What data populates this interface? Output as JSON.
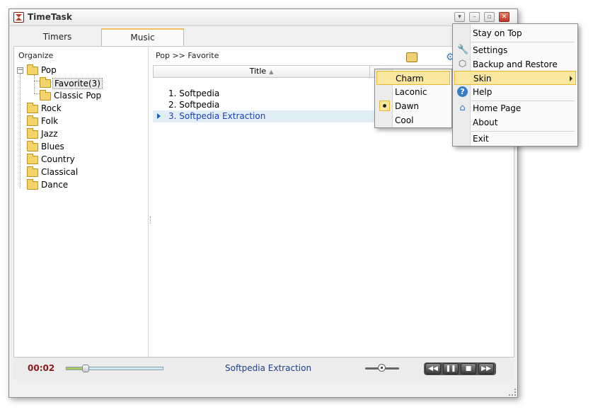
{
  "window": {
    "title": "TimeTask"
  },
  "tabs": [
    {
      "label": "Timers",
      "active": false
    },
    {
      "label": "Music",
      "active": true
    }
  ],
  "organize": {
    "label": "Organize",
    "tree": [
      {
        "label": "Pop",
        "expanded": true
      },
      {
        "label": "Favorite(3)",
        "selected": true
      },
      {
        "label": "Classic Pop"
      },
      {
        "label": "Rock"
      },
      {
        "label": "Folk"
      },
      {
        "label": "Jazz"
      },
      {
        "label": "Blues"
      },
      {
        "label": "Country"
      },
      {
        "label": "Classical"
      },
      {
        "label": "Dance"
      }
    ]
  },
  "playlist": {
    "breadcrumb": "Pop >> Favorite",
    "column_title": "Title",
    "songs": [
      {
        "label": "1. Softpedia"
      },
      {
        "label": "2. Softpedia"
      },
      {
        "label": "3. Softpedia Extraction",
        "playing": true
      }
    ]
  },
  "player": {
    "time": "00:02",
    "track": "Softpedia Extraction",
    "seek_fraction": 0.2,
    "volume_fraction": 0.5
  },
  "main_menu": [
    {
      "label": "Stay on Top"
    },
    {
      "label": "Settings",
      "icon": "wrench-icon"
    },
    {
      "label": "Backup and Restore",
      "icon": "backup-icon"
    },
    {
      "label": "Skin",
      "highlighted": true,
      "has_submenu": true
    },
    {
      "label": "Help",
      "icon": "help-icon"
    },
    {
      "label": "Home Page",
      "icon": "home-icon"
    },
    {
      "label": "About"
    },
    {
      "label": "Exit"
    }
  ],
  "skin_menu": [
    {
      "label": "Charm",
      "highlighted": true
    },
    {
      "label": "Laconic"
    },
    {
      "label": "Dawn",
      "checked": true
    },
    {
      "label": "Cool"
    }
  ],
  "colors": {
    "time": "#8b1a1a",
    "track": "#1d3f8b",
    "active_song": "#1d3fb5",
    "menu_highlight": "#fbe8a0"
  }
}
